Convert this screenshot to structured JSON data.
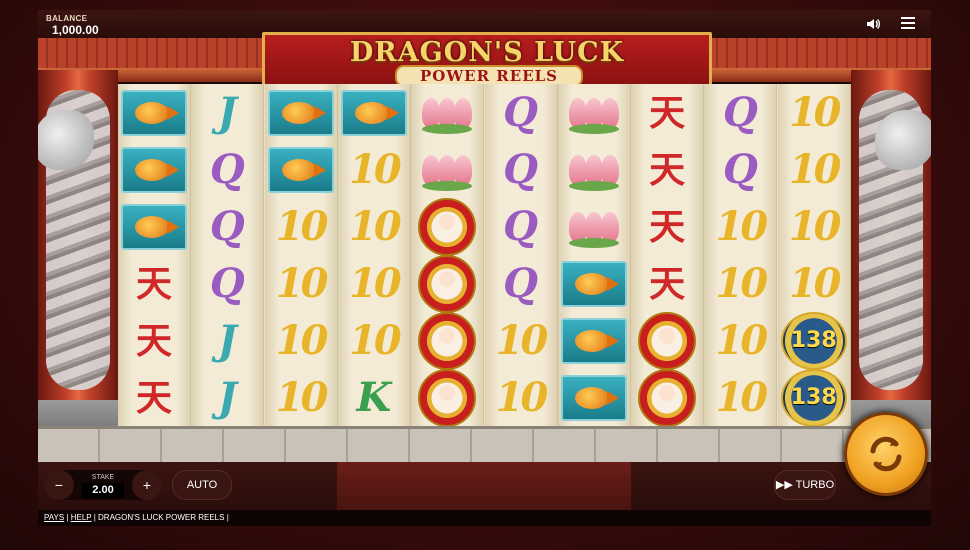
{
  "topbar": {
    "balance_label": "BALANCE",
    "balance_value": "1,000.00",
    "speaker_icon": "speaker-icon",
    "menu_icon": "hamburger-menu-icon"
  },
  "logo": {
    "title": "DRAGON'S LUCK",
    "subtitle": "POWER REELS"
  },
  "reels": [
    [
      "fish",
      "fish",
      "fish",
      "A",
      "A",
      "A"
    ],
    [
      "J",
      "Q",
      "Q",
      "Q",
      "J",
      "J"
    ],
    [
      "fish",
      "fish",
      "10",
      "10",
      "10",
      "10"
    ],
    [
      "fish",
      "10",
      "10",
      "10",
      "10",
      "K"
    ],
    [
      "lotus",
      "lotus",
      "doll",
      "doll",
      "doll",
      "doll"
    ],
    [
      "Q",
      "Q",
      "Q",
      "Q",
      "10",
      "10"
    ],
    [
      "lotus",
      "lotus",
      "lotus",
      "fish",
      "fish",
      "fish"
    ],
    [
      "A",
      "A",
      "A",
      "A",
      "doll",
      "doll"
    ],
    [
      "Q",
      "Q",
      "10",
      "10",
      "10",
      "10"
    ],
    [
      "10",
      "10",
      "10",
      "10",
      "coin",
      "coin"
    ]
  ],
  "symbol_text": {
    "J": "J",
    "Q": "Q",
    "K": "K",
    "10": "10",
    "A": "天",
    "coin": "138"
  },
  "controls": {
    "minus": "−",
    "plus": "+",
    "stake_label": "STAKE",
    "stake_value": "2.00",
    "auto_label": "AUTO",
    "turbo_label": "TURBO",
    "turbo_icon": "fast-forward-icon",
    "spin_icon": "spin-arrows-icon"
  },
  "footer": {
    "pays": "PAYS",
    "help": "HELP",
    "game_name": "DRAGON'S LUCK POWER REELS"
  },
  "colors": {
    "accent_gold": "#f0a020",
    "temple_red": "#b81e1e",
    "background": "#3a0c0b"
  }
}
